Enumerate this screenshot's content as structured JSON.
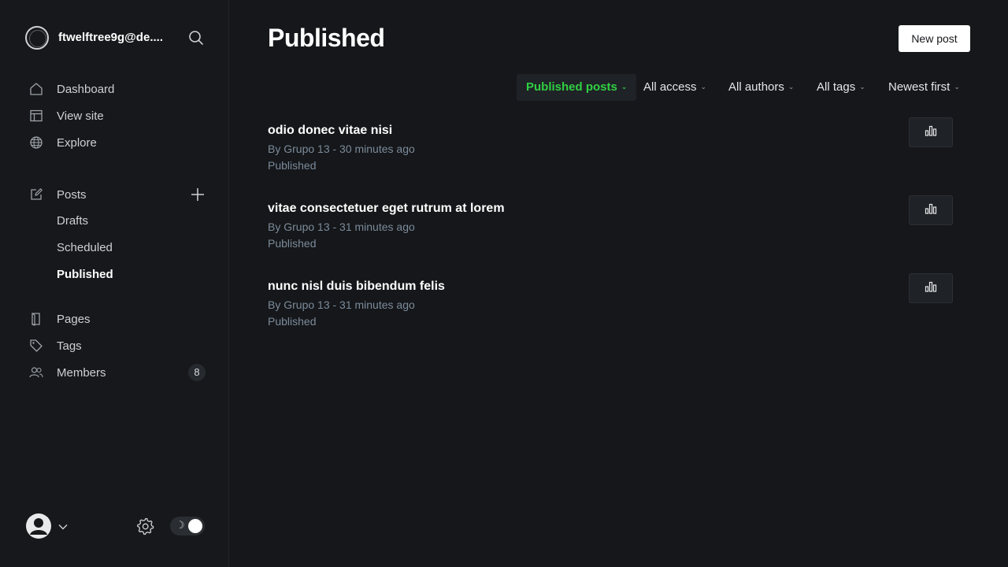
{
  "sidebar": {
    "site_title": "ftwelftree9g@de....",
    "nav": {
      "dashboard": "Dashboard",
      "view_site": "View site",
      "explore": "Explore",
      "posts": "Posts",
      "drafts": "Drafts",
      "scheduled": "Scheduled",
      "published": "Published",
      "pages": "Pages",
      "tags": "Tags",
      "members": "Members",
      "members_count": "8"
    },
    "theme_icon": "☽"
  },
  "main": {
    "title": "Published",
    "new_post_label": "New post",
    "filters": {
      "type": "Published posts",
      "access": "All access",
      "authors": "All authors",
      "tags": "All tags",
      "sort": "Newest first"
    },
    "posts": [
      {
        "title": "odio donec vitae nisi",
        "meta": "By Grupo 13 - 30 minutes ago",
        "status": "Published"
      },
      {
        "title": "vitae consectetuer eget rutrum at lorem",
        "meta": "By Grupo 13 - 31 minutes ago",
        "status": "Published"
      },
      {
        "title": "nunc nisl duis bibendum felis",
        "meta": "By Grupo 13 - 31 minutes ago",
        "status": "Published"
      }
    ]
  },
  "colors": {
    "background": "#15171a",
    "accent_green": "#30cf43",
    "muted_text": "#7c8b9a"
  }
}
